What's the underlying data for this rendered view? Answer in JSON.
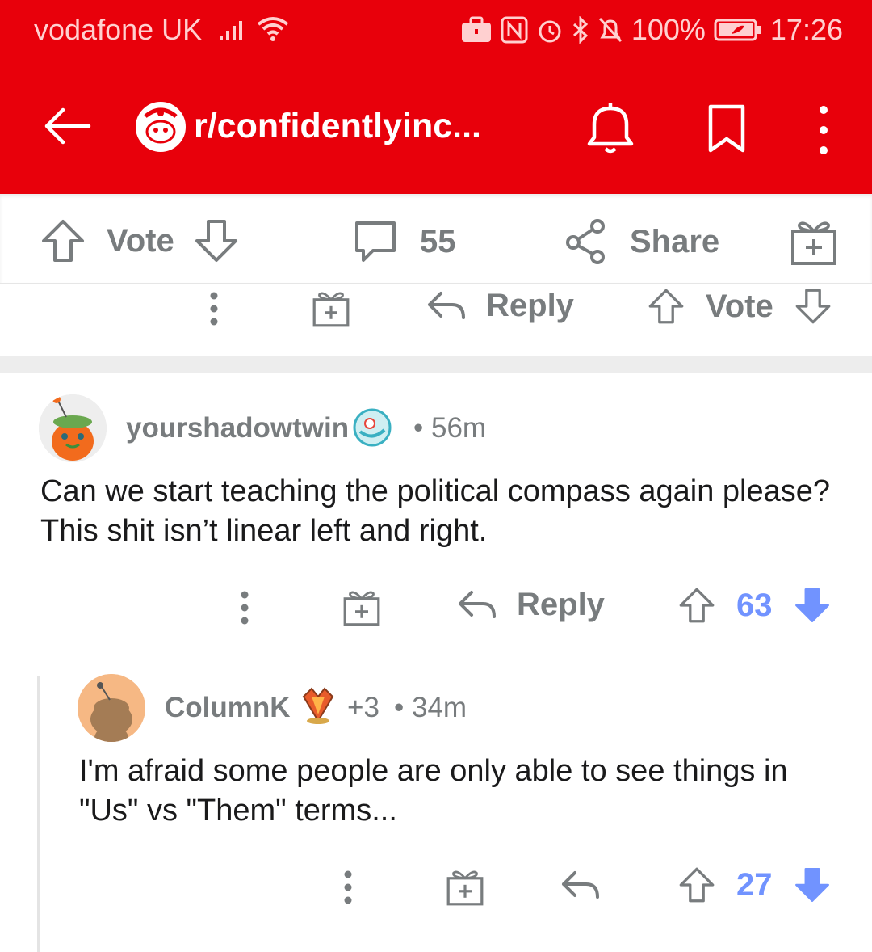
{
  "status_bar": {
    "carrier": "vodafone UK",
    "battery": "100%",
    "time": "17:26"
  },
  "header": {
    "subreddit": "r/confidentlyinc..."
  },
  "post_actions": {
    "vote_label": "Vote",
    "comments_count": "55",
    "share_label": "Share"
  },
  "prev_comment_actions": {
    "reply_label": "Reply",
    "vote_label": "Vote"
  },
  "comments": [
    {
      "username": "yourshadowtwin",
      "time": "• 56m",
      "body": "Can we start teaching the political compass again please? This shit isn’t linear left and right.",
      "reply_label": "Reply",
      "score": "63",
      "colors": {
        "vote_active": "#7193ff"
      }
    },
    {
      "username": "ColumnK",
      "awards": "+3",
      "time": "• 34m",
      "body": "I'm afraid some people are only able to see things in \"Us\" vs \"Them\" terms...",
      "score": "27"
    }
  ],
  "colors": {
    "header_red": "#e8000b",
    "muted": "#787c7e",
    "score_blue": "#7193ff"
  }
}
